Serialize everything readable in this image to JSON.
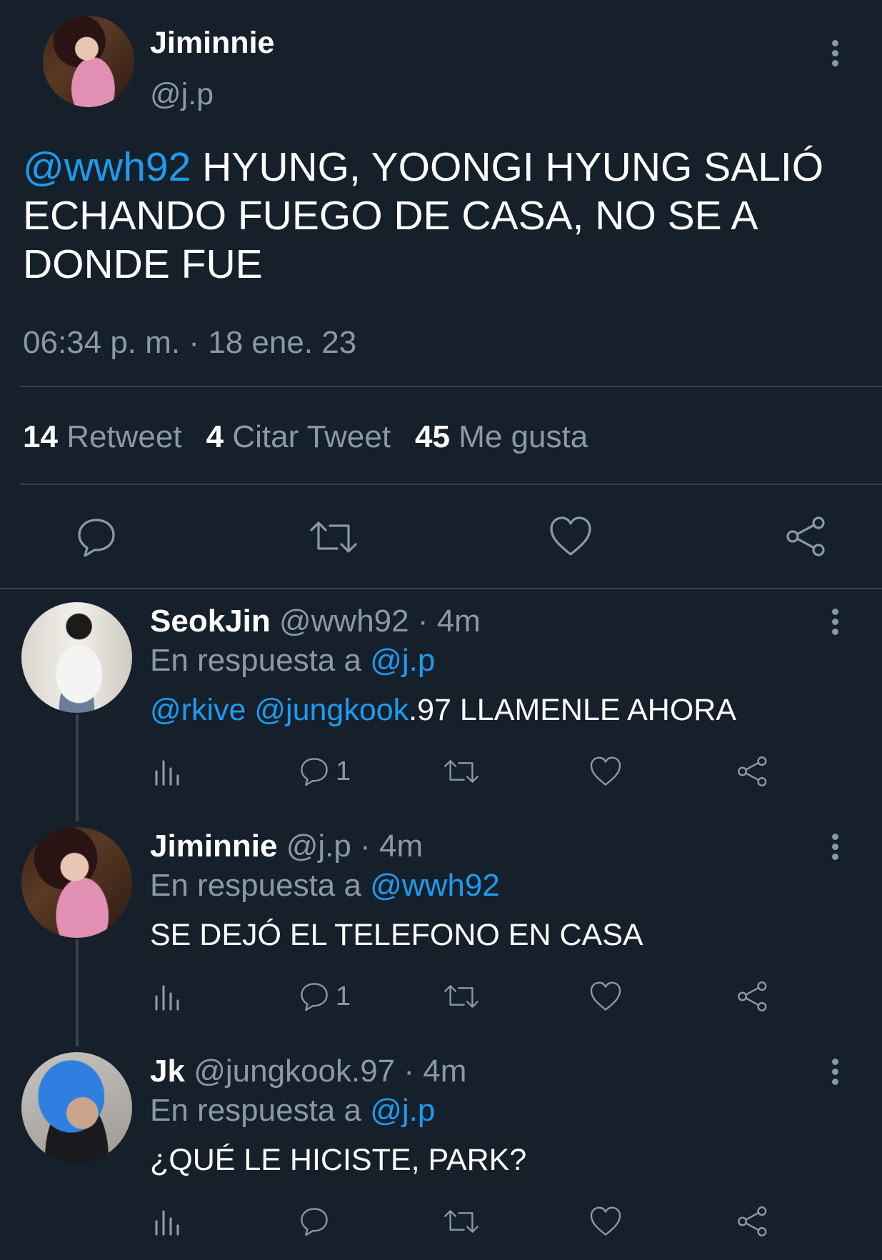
{
  "main_tweet": {
    "display_name": "Jiminnie",
    "handle": "@j.p",
    "mention": "@wwh92",
    "text": " HYUNG, YOONGI HYUNG SALIÓ ECHANDO FUEGO DE CASA, NO SE A DONDE FUE",
    "timestamp": "06:34 p. m. · 18 ene. 23",
    "stats": {
      "retweets_count": "14",
      "retweets_label": "Retweet",
      "quotes_count": "4",
      "quotes_label": "Citar Tweet",
      "likes_count": "45",
      "likes_label": "Me gusta"
    }
  },
  "replies": [
    {
      "display_name": "SeokJin",
      "handle_time": "@wwh92 · 4m",
      "reply_prefix": "En respuesta a",
      "reply_to": "@j.p",
      "text_mentions": "@rkive @jungkook",
      "text_rest": ".97 LLAMENLE AHORA",
      "reply_count": "1"
    },
    {
      "display_name": "Jiminnie",
      "handle_time": "@j.p · 4m",
      "reply_prefix": "En respuesta a",
      "reply_to": "@wwh92",
      "text_mentions": "",
      "text_rest": "SE DEJÓ EL TELEFONO EN CASA",
      "reply_count": "1"
    },
    {
      "display_name": "Jk",
      "handle_time": "@jungkook.97 · 4m",
      "reply_prefix": "En respuesta a",
      "reply_to": "@j.p",
      "text_mentions": "",
      "text_rest": "¿QUÉ LE HICISTE, PARK?",
      "reply_count": ""
    }
  ],
  "icons": {
    "reply": "reply-icon",
    "retweet": "retweet-icon",
    "like": "heart-icon",
    "share": "share-icon",
    "views": "analytics-icon",
    "more": "more-vertical-icon"
  },
  "colors": {
    "background": "#15202b",
    "link": "#1d9bf0",
    "muted": "#8b98a5",
    "divider": "#38444d"
  }
}
